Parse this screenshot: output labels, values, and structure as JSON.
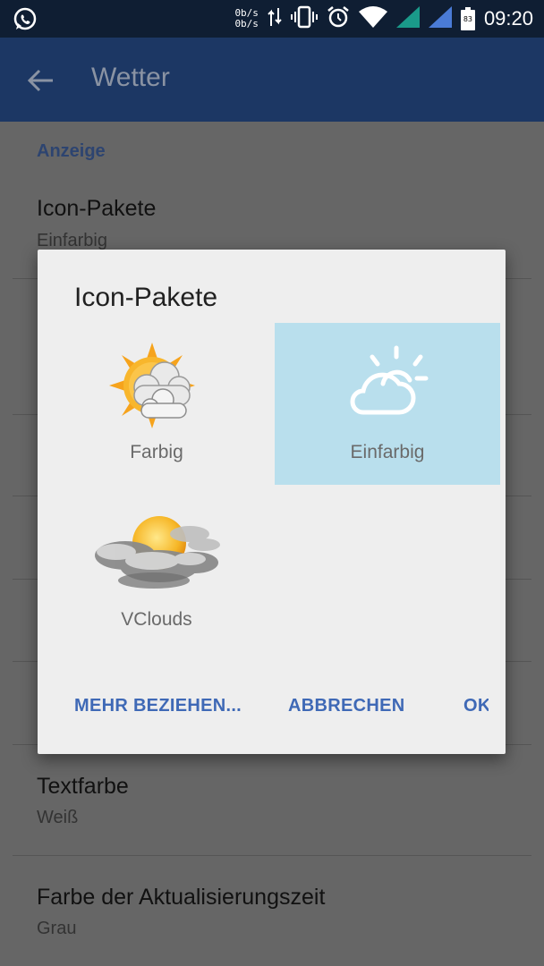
{
  "status_bar": {
    "net_up": "0b/s",
    "net_down": "0b/s",
    "battery": "83",
    "time": "09:20",
    "icons": [
      "whatsapp-icon",
      "data-transfer-icon",
      "vibrate-icon",
      "alarm-icon",
      "wifi-icon",
      "signal-icon",
      "battery-icon"
    ]
  },
  "app_bar": {
    "title": "Wetter"
  },
  "settings": {
    "section_header": "Anzeige",
    "items": [
      {
        "title": "Icon-Pakete",
        "subtitle": "Einfarbig"
      },
      {
        "title": "Textfarbe",
        "subtitle": "Weiß"
      },
      {
        "title": "Farbe der Aktualisierungszeit",
        "subtitle": "Grau"
      }
    ]
  },
  "dialog": {
    "title": "Icon-Pakete",
    "packs": [
      {
        "label": "Farbig",
        "selected": false
      },
      {
        "label": "Einfarbig",
        "selected": true
      },
      {
        "label": "VClouds",
        "selected": false
      }
    ],
    "buttons": {
      "more": "MEHR BEZIEHEN...",
      "cancel": "ABBRECHEN",
      "ok": "OK"
    }
  },
  "colors": {
    "status_bar": "#0f1e33",
    "app_bar": "#1c3764",
    "accent": "#3f69b6",
    "selection": "#b9dfed",
    "scrim_background": "#666666"
  }
}
